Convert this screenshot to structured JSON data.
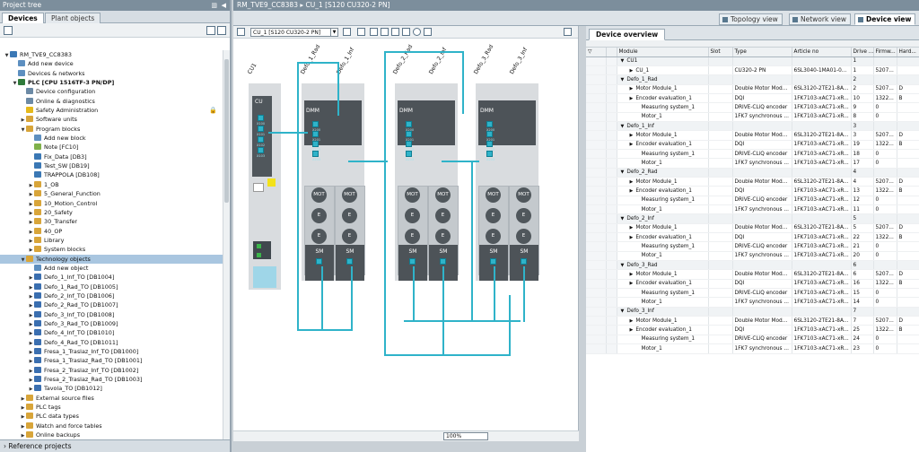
{
  "project_tree": {
    "title": "Project tree",
    "tabs": [
      "Devices",
      "Plant objects"
    ],
    "bottom_panel": "Reference projects",
    "items": [
      {
        "label": "RM_TVE9_CC8383",
        "level": 0,
        "arrow": "▼",
        "icon": "#3b78b5"
      },
      {
        "label": "Add new device",
        "level": 1,
        "arrow": "",
        "icon": "#5d8fc0"
      },
      {
        "label": "Devices & networks",
        "level": 1,
        "arrow": "",
        "icon": "#5d8fc0"
      },
      {
        "label": "PLC [CPU 1516TF-3 PN/DP]",
        "level": 1,
        "arrow": "▼",
        "icon": "#2f7a3a",
        "bold": true
      },
      {
        "label": "Device configuration",
        "level": 2,
        "arrow": "",
        "icon": "#6c8aa5"
      },
      {
        "label": "Online & diagnostics",
        "level": 2,
        "arrow": "",
        "icon": "#6c8aa5"
      },
      {
        "label": "Safety Administration",
        "level": 2,
        "arrow": "",
        "icon": "#e5b91b",
        "lock": true
      },
      {
        "label": "Software units",
        "level": 2,
        "arrow": "▶",
        "icon": "#d8a53a"
      },
      {
        "label": "Program blocks",
        "level": 2,
        "arrow": "▼",
        "icon": "#d8a53a"
      },
      {
        "label": "Add new block",
        "level": 3,
        "arrow": "",
        "icon": "#5d8fc0"
      },
      {
        "label": "Note [FC10]",
        "level": 3,
        "arrow": "",
        "icon": "#7fb14a"
      },
      {
        "label": "Fix_Data [DB3]",
        "level": 3,
        "arrow": "",
        "icon": "#3b78b5"
      },
      {
        "label": "Test_SW [DB19]",
        "level": 3,
        "arrow": "",
        "icon": "#3b78b5"
      },
      {
        "label": "TRAPPOLA [DB108]",
        "level": 3,
        "arrow": "",
        "icon": "#3b78b5"
      },
      {
        "label": "1_OB",
        "level": 3,
        "arrow": "▶",
        "icon": "#d8a53a"
      },
      {
        "label": "5_General_Function",
        "level": 3,
        "arrow": "▶",
        "icon": "#d8a53a"
      },
      {
        "label": "10_Motion_Control",
        "level": 3,
        "arrow": "▶",
        "icon": "#d8a53a"
      },
      {
        "label": "20_Safety",
        "level": 3,
        "arrow": "▶",
        "icon": "#d8a53a"
      },
      {
        "label": "30_Transfer",
        "level": 3,
        "arrow": "▶",
        "icon": "#d8a53a"
      },
      {
        "label": "40_OP",
        "level": 3,
        "arrow": "▶",
        "icon": "#d8a53a"
      },
      {
        "label": "Library",
        "level": 3,
        "arrow": "▶",
        "icon": "#d8a53a"
      },
      {
        "label": "System blocks",
        "level": 3,
        "arrow": "▶",
        "icon": "#d8a53a"
      },
      {
        "label": "Technology objects",
        "level": 2,
        "arrow": "▼",
        "icon": "#d8a53a",
        "selected": true
      },
      {
        "label": "Add new object",
        "level": 3,
        "arrow": "",
        "icon": "#5d8fc0"
      },
      {
        "label": "Defo_1_Inf_TO [DB1004]",
        "level": 3,
        "arrow": "▶",
        "icon": "#3b6fb0"
      },
      {
        "label": "Defo_1_Rad_TO [DB1005]",
        "level": 3,
        "arrow": "▶",
        "icon": "#3b6fb0"
      },
      {
        "label": "Defo_2_Inf_TO [DB1006]",
        "level": 3,
        "arrow": "▶",
        "icon": "#3b6fb0"
      },
      {
        "label": "Defo_2_Rad_TO [DB1007]",
        "level": 3,
        "arrow": "▶",
        "icon": "#3b6fb0"
      },
      {
        "label": "Defo_3_Inf_TO [DB1008]",
        "level": 3,
        "arrow": "▶",
        "icon": "#3b6fb0"
      },
      {
        "label": "Defo_3_Rad_TO [DB1009]",
        "level": 3,
        "arrow": "▶",
        "icon": "#3b6fb0"
      },
      {
        "label": "Defo_4_Inf_TO [DB1010]",
        "level": 3,
        "arrow": "▶",
        "icon": "#3b6fb0"
      },
      {
        "label": "Defo_4_Rad_TO [DB1011]",
        "level": 3,
        "arrow": "▶",
        "icon": "#3b6fb0"
      },
      {
        "label": "Fresa_1_Traslaz_Inf_TO [DB1000]",
        "level": 3,
        "arrow": "▶",
        "icon": "#3b6fb0"
      },
      {
        "label": "Fresa_1_Traslaz_Rad_TO [DB1001]",
        "level": 3,
        "arrow": "▶",
        "icon": "#3b6fb0"
      },
      {
        "label": "Fresa_2_Traslaz_Inf_TO [DB1002]",
        "level": 3,
        "arrow": "▶",
        "icon": "#3b6fb0"
      },
      {
        "label": "Fresa_2_Traslaz_Rad_TO [DB1003]",
        "level": 3,
        "arrow": "▶",
        "icon": "#3b6fb0"
      },
      {
        "label": "Tavola_TO [DB1012]",
        "level": 3,
        "arrow": "▶",
        "icon": "#3b6fb0"
      },
      {
        "label": "External source files",
        "level": 2,
        "arrow": "▶",
        "icon": "#d8a53a"
      },
      {
        "label": "PLC tags",
        "level": 2,
        "arrow": "▶",
        "icon": "#d8a53a"
      },
      {
        "label": "PLC data types",
        "level": 2,
        "arrow": "▶",
        "icon": "#d8a53a"
      },
      {
        "label": "Watch and force tables",
        "level": 2,
        "arrow": "▶",
        "icon": "#d8a53a"
      },
      {
        "label": "Online backups",
        "level": 2,
        "arrow": "▶",
        "icon": "#d8a53a"
      }
    ]
  },
  "editor": {
    "breadcrumb": "RM_TVE9_CC8383 ▸ CU_1 [S120 CU320-2 PN]",
    "views": [
      "Topology view",
      "Network view",
      "Device view"
    ],
    "device_select": "CU_1 [S120 CU320-2 PN]",
    "zoom": "100%",
    "cu_label": "CU1",
    "cu_text": "CU",
    "cu_ports": [
      "X100",
      "X101",
      "X102",
      "X103"
    ],
    "dmm_text": "DMM",
    "mot_text": "MOT",
    "e_text": "E",
    "sm_text": "SM",
    "dmm_ports": [
      "X200",
      "X201",
      "X202",
      "X203"
    ],
    "sm_port": "X500",
    "drive_labels": [
      "Defo_1_Rad",
      "Defo_1_Inf",
      "Defo_2_Rad",
      "Defo_2_Inf",
      "Defo_3_Rad",
      "Defo_3_Inf"
    ]
  },
  "overview": {
    "tab": "Device overview",
    "columns": [
      "Module",
      "Slot",
      "Type",
      "Article no",
      "Drive ...",
      "Firmw...",
      "Hard..."
    ],
    "rows": [
      {
        "m": "CU1",
        "lvl": 0,
        "arrow": "▼",
        "slot": "",
        "type": "",
        "art": "",
        "drv": "1",
        "fw": "",
        "hw": "",
        "grp": true
      },
      {
        "m": "CU_1",
        "lvl": 1,
        "arrow": "▶",
        "slot": "",
        "type": "CU320-2 PN",
        "art": "6SL3040-1MA01-0...",
        "drv": "1",
        "fw": "5207...",
        "hw": ""
      },
      {
        "m": "Defo_1_Rad",
        "lvl": 0,
        "arrow": "▼",
        "slot": "",
        "type": "",
        "art": "",
        "drv": "2",
        "fw": "",
        "hw": "",
        "grp": true
      },
      {
        "m": "Motor Module_1",
        "lvl": 1,
        "arrow": "▶",
        "slot": "",
        "type": "Double Motor Mod...",
        "art": "6SL3120-2TE21-8A...",
        "drv": "2",
        "fw": "5207...",
        "hw": "D"
      },
      {
        "m": "Encoder evaluation_1",
        "lvl": 1,
        "arrow": "▶",
        "slot": "",
        "type": "DQI",
        "art": "1FK7103-xAC71-xR...",
        "drv": "10",
        "fw": "1322...",
        "hw": "B"
      },
      {
        "m": "Measuring system_1",
        "lvl": 2,
        "arrow": "",
        "slot": "",
        "type": "DRIVE-CLiQ encoder",
        "art": "1FK7103-xAC71-xR...",
        "drv": "9",
        "fw": "0",
        "hw": ""
      },
      {
        "m": "Motor_1",
        "lvl": 2,
        "arrow": "",
        "slot": "",
        "type": "1FK7 synchronous ...",
        "art": "1FK7103-xAC71-xR...",
        "drv": "8",
        "fw": "0",
        "hw": ""
      },
      {
        "m": "Defo_1_Inf",
        "lvl": 0,
        "arrow": "▼",
        "slot": "",
        "type": "",
        "art": "",
        "drv": "3",
        "fw": "",
        "hw": "",
        "grp": true
      },
      {
        "m": "Motor Module_1",
        "lvl": 1,
        "arrow": "▶",
        "slot": "",
        "type": "Double Motor Mod...",
        "art": "6SL3120-2TE21-8A...",
        "drv": "3",
        "fw": "5207...",
        "hw": "D"
      },
      {
        "m": "Encoder evaluation_1",
        "lvl": 1,
        "arrow": "▶",
        "slot": "",
        "type": "DQI",
        "art": "1FK7103-xAC71-xR...",
        "drv": "19",
        "fw": "1322...",
        "hw": "B"
      },
      {
        "m": "Measuring system_1",
        "lvl": 2,
        "arrow": "",
        "slot": "",
        "type": "DRIVE-CLiQ encoder",
        "art": "1FK7103-xAC71-xR...",
        "drv": "18",
        "fw": "0",
        "hw": ""
      },
      {
        "m": "Motor_1",
        "lvl": 2,
        "arrow": "",
        "slot": "",
        "type": "1FK7 synchronous ...",
        "art": "1FK7103-xAC71-xR...",
        "drv": "17",
        "fw": "0",
        "hw": ""
      },
      {
        "m": "Defo_2_Rad",
        "lvl": 0,
        "arrow": "▼",
        "slot": "",
        "type": "",
        "art": "",
        "drv": "4",
        "fw": "",
        "hw": "",
        "grp": true
      },
      {
        "m": "Motor Module_1",
        "lvl": 1,
        "arrow": "▶",
        "slot": "",
        "type": "Double Motor Mod...",
        "art": "6SL3120-2TE21-8A...",
        "drv": "4",
        "fw": "5207...",
        "hw": "D"
      },
      {
        "m": "Encoder evaluation_1",
        "lvl": 1,
        "arrow": "▶",
        "slot": "",
        "type": "DQI",
        "art": "1FK7103-xAC71-xR...",
        "drv": "13",
        "fw": "1322...",
        "hw": "B"
      },
      {
        "m": "Measuring system_1",
        "lvl": 2,
        "arrow": "",
        "slot": "",
        "type": "DRIVE-CLiQ encoder",
        "art": "1FK7103-xAC71-xR...",
        "drv": "12",
        "fw": "0",
        "hw": ""
      },
      {
        "m": "Motor_1",
        "lvl": 2,
        "arrow": "",
        "slot": "",
        "type": "1FK7 synchronous ...",
        "art": "1FK7103-xAC71-xR...",
        "drv": "11",
        "fw": "0",
        "hw": ""
      },
      {
        "m": "Defo_2_Inf",
        "lvl": 0,
        "arrow": "▼",
        "slot": "",
        "type": "",
        "art": "",
        "drv": "5",
        "fw": "",
        "hw": "",
        "grp": true
      },
      {
        "m": "Motor Module_1",
        "lvl": 1,
        "arrow": "▶",
        "slot": "",
        "type": "Double Motor Mod...",
        "art": "6SL3120-2TE21-8A...",
        "drv": "5",
        "fw": "5207...",
        "hw": "D"
      },
      {
        "m": "Encoder evaluation_1",
        "lvl": 1,
        "arrow": "▶",
        "slot": "",
        "type": "DQI",
        "art": "1FK7103-xAC71-xR...",
        "drv": "22",
        "fw": "1322...",
        "hw": "B"
      },
      {
        "m": "Measuring system_1",
        "lvl": 2,
        "arrow": "",
        "slot": "",
        "type": "DRIVE-CLiQ encoder",
        "art": "1FK7103-xAC71-xR...",
        "drv": "21",
        "fw": "0",
        "hw": ""
      },
      {
        "m": "Motor_1",
        "lvl": 2,
        "arrow": "",
        "slot": "",
        "type": "1FK7 synchronous ...",
        "art": "1FK7103-xAC71-xR...",
        "drv": "20",
        "fw": "0",
        "hw": ""
      },
      {
        "m": "Defo_3_Rad",
        "lvl": 0,
        "arrow": "▼",
        "slot": "",
        "type": "",
        "art": "",
        "drv": "6",
        "fw": "",
        "hw": "",
        "grp": true
      },
      {
        "m": "Motor Module_1",
        "lvl": 1,
        "arrow": "▶",
        "slot": "",
        "type": "Double Motor Mod...",
        "art": "6SL3120-2TE21-8A...",
        "drv": "6",
        "fw": "5207...",
        "hw": "D"
      },
      {
        "m": "Encoder evaluation_1",
        "lvl": 1,
        "arrow": "▶",
        "slot": "",
        "type": "DQI",
        "art": "1FK7103-xAC71-xR...",
        "drv": "16",
        "fw": "1322...",
        "hw": "B"
      },
      {
        "m": "Measuring system_1",
        "lvl": 2,
        "arrow": "",
        "slot": "",
        "type": "DRIVE-CLiQ encoder",
        "art": "1FK7103-xAC71-xR...",
        "drv": "15",
        "fw": "0",
        "hw": ""
      },
      {
        "m": "Motor_1",
        "lvl": 2,
        "arrow": "",
        "slot": "",
        "type": "1FK7 synchronous ...",
        "art": "1FK7103-xAC71-xR...",
        "drv": "14",
        "fw": "0",
        "hw": ""
      },
      {
        "m": "Defo_3_Inf",
        "lvl": 0,
        "arrow": "▼",
        "slot": "",
        "type": "",
        "art": "",
        "drv": "7",
        "fw": "",
        "hw": "",
        "grp": true
      },
      {
        "m": "Motor Module_1",
        "lvl": 1,
        "arrow": "▶",
        "slot": "",
        "type": "Double Motor Mod...",
        "art": "6SL3120-2TE21-8A...",
        "drv": "7",
        "fw": "5207...",
        "hw": "D"
      },
      {
        "m": "Encoder evaluation_1",
        "lvl": 1,
        "arrow": "▶",
        "slot": "",
        "type": "DQI",
        "art": "1FK7103-xAC71-xR...",
        "drv": "25",
        "fw": "1322...",
        "hw": "B"
      },
      {
        "m": "Measuring system_1",
        "lvl": 2,
        "arrow": "",
        "slot": "",
        "type": "DRIVE-CLiQ encoder",
        "art": "1FK7103-xAC71-xR...",
        "drv": "24",
        "fw": "0",
        "hw": ""
      },
      {
        "m": "Motor_1",
        "lvl": 2,
        "arrow": "",
        "slot": "",
        "type": "1FK7 synchronous ...",
        "art": "1FK7103-xAC71-xR...",
        "drv": "23",
        "fw": "0",
        "hw": ""
      }
    ]
  }
}
